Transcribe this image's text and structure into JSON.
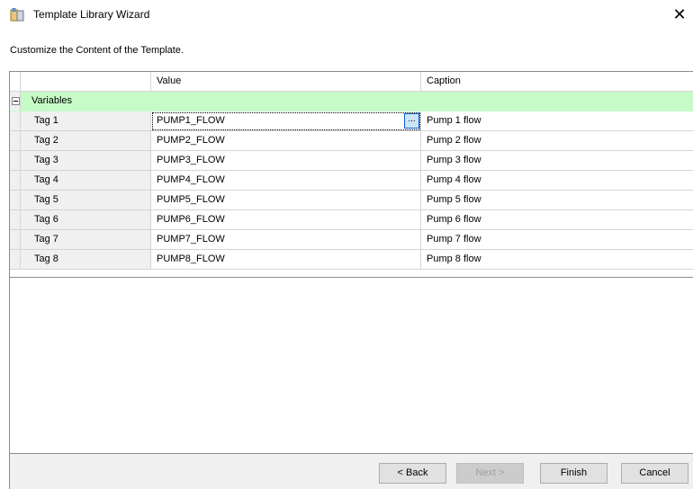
{
  "window": {
    "title": "Template Library Wizard",
    "close_symbol": "✕",
    "icon": "template-library-icon"
  },
  "subtitle": "Customize the Content of the Template.",
  "grid": {
    "columns": [
      "",
      "Value",
      "Caption"
    ],
    "category": {
      "label": "Variables",
      "expanded": true,
      "toggle_symbol": "minus",
      "color": "#c6fbc8"
    },
    "rows": [
      {
        "name": "Tag 1",
        "value": "PUMP1_FLOW",
        "caption": "Pump 1 flow",
        "selected": true
      },
      {
        "name": "Tag 2",
        "value": "PUMP2_FLOW",
        "caption": "Pump 2 flow"
      },
      {
        "name": "Tag 3",
        "value": "PUMP3_FLOW",
        "caption": "Pump 3 flow"
      },
      {
        "name": "Tag 4",
        "value": "PUMP4_FLOW",
        "caption": "Pump 4 flow"
      },
      {
        "name": "Tag 5",
        "value": "PUMP5_FLOW",
        "caption": "Pump 5 flow"
      },
      {
        "name": "Tag 6",
        "value": "PUMP6_FLOW",
        "caption": "Pump 6 flow"
      },
      {
        "name": "Tag 7",
        "value": "PUMP7_FLOW",
        "caption": "Pump 7 flow"
      },
      {
        "name": "Tag 8",
        "value": "PUMP8_FLOW",
        "caption": "Pump 8 flow"
      }
    ],
    "ellipsis_label": "..."
  },
  "buttons": {
    "back": "< Back",
    "next": "Next >",
    "finish": "Finish",
    "cancel": "Cancel"
  }
}
